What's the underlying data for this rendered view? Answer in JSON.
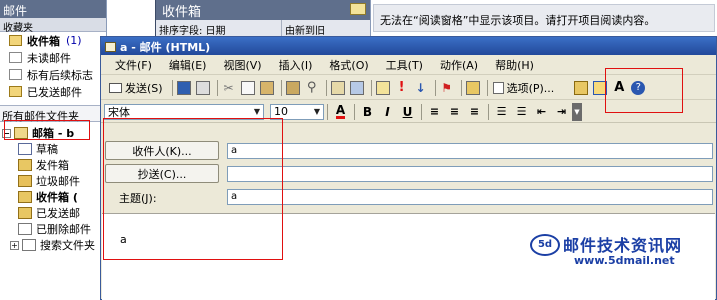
{
  "left_pane": {
    "title": "邮件",
    "favorites_header": "收藏夹",
    "favorites": [
      {
        "label": "收件箱",
        "count": "(1)",
        "bold": true
      },
      {
        "label": "未读邮件"
      },
      {
        "label": "标有后续标志"
      },
      {
        "label": "已发送邮件"
      }
    ],
    "all_folders_header": "所有邮件文件夹",
    "tree": {
      "mailbox": "邮箱 - b",
      "folders": [
        "草稿",
        "发件箱",
        "垃圾邮件",
        "收件箱 (",
        "已发送邮",
        "已删除邮件",
        "搜索文件夹"
      ]
    }
  },
  "message_list": {
    "title": "收件箱",
    "sort_label": "排序字段: 日期",
    "col2": "由新到旧"
  },
  "reading_pane": {
    "message": "无法在“阅读窗格”中显示该项目。请打开项目阅读内容。"
  },
  "compose": {
    "title": "a - 邮件 (HTML)",
    "menu": [
      "文件(F)",
      "编辑(E)",
      "视图(V)",
      "插入(I)",
      "格式(O)",
      "工具(T)",
      "动作(A)",
      "帮助(H)"
    ],
    "toolbar": {
      "send_label": "发送(S)",
      "options_label": "选项(P)..."
    },
    "format": {
      "font": "宋体",
      "size": "10"
    },
    "to_button": "收件人(K)...",
    "cc_button": "抄送(C)...",
    "subject_label": "主题(J):",
    "to_value": "a",
    "cc_value": "",
    "subject_value": "a",
    "body_text": "a"
  },
  "watermark": {
    "title": "邮件技术资讯网",
    "url": "www.5dmail.net",
    "brand": "5d"
  },
  "colors": {
    "accent_red": "#e01010",
    "titlebar": "#2a57b0",
    "watermark": "#1b3fa5"
  }
}
